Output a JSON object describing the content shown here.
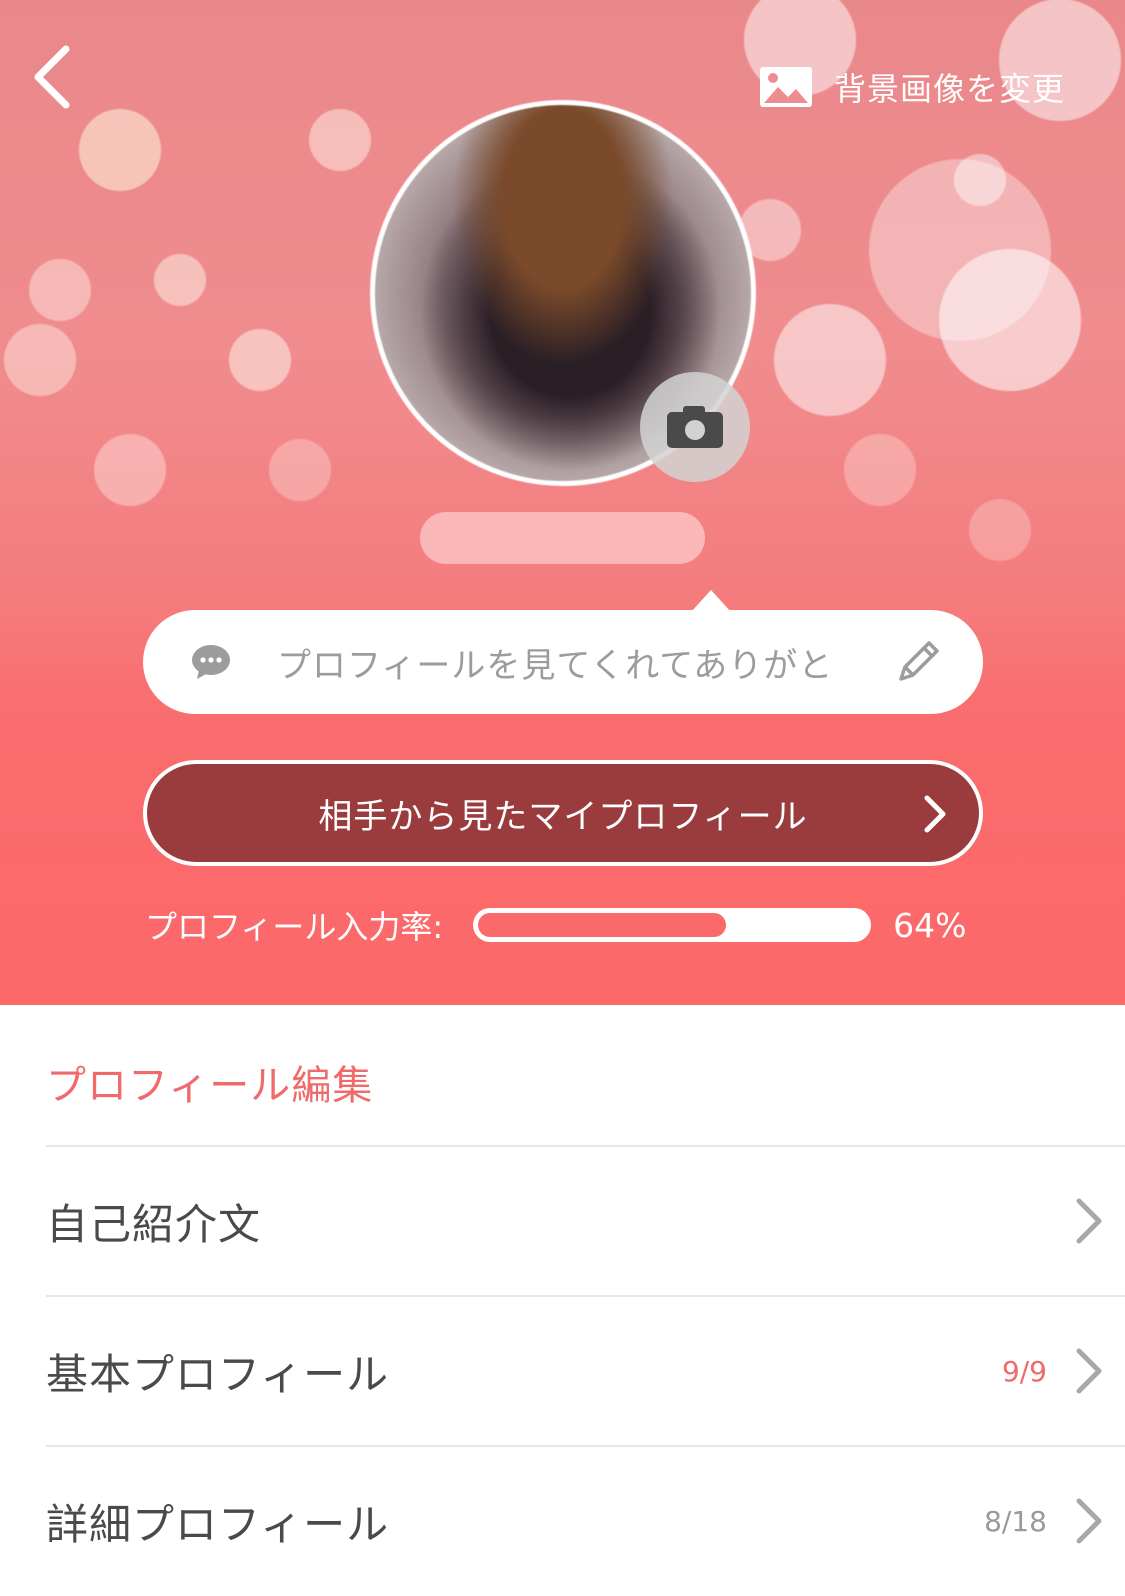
{
  "header": {
    "change_background_label": "背景画像を変更",
    "message_placeholder": "プロフィールを見てくれてありがと",
    "view_profile_button": "相手から見たマイプロフィール",
    "progress_label": "プロフィール入力率:",
    "progress_percent_text": "64%",
    "progress_fraction": 0.64,
    "accent_color": "#fd6869",
    "button_color": "#9a3b3e"
  },
  "icons": {
    "back": "chevron-left-icon",
    "image": "image-icon",
    "camera": "camera-icon",
    "chat": "chat-bubble-icon",
    "pencil": "pencil-icon"
  },
  "edit_section": {
    "title": "プロフィール編集",
    "title_color": "#f06a6c",
    "items": [
      {
        "label": "自己紹介文",
        "count": "",
        "count_color": "#f06a6c"
      },
      {
        "label": "基本プロフィール",
        "count": "9/9",
        "count_color": "#f06a6c"
      },
      {
        "label": "詳細プロフィール",
        "count": "8/18",
        "count_color": "#9a9a9a"
      }
    ]
  }
}
